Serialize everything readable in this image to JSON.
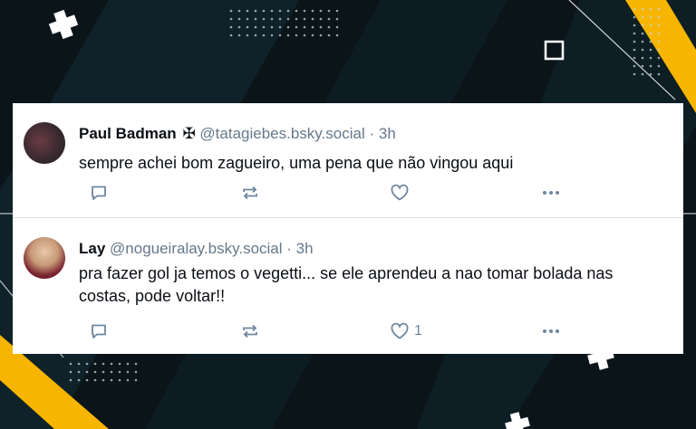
{
  "colors": {
    "background": "#0b1418",
    "accent_yellow": "#f7b500",
    "card": "#ffffff",
    "muted_text": "#66788a",
    "action_icon": "#6f869f"
  },
  "posts": [
    {
      "display_name": "Paul Badman",
      "badge": "✠",
      "handle": "@tatagiebes.bsky.social",
      "separator": "·",
      "time": "3h",
      "text": "sempre achei bom zagueiro, uma pena que não vingou aqui",
      "like_count": ""
    },
    {
      "display_name": "Lay",
      "badge": "",
      "handle": "@nogueiralay.bsky.social",
      "separator": "·",
      "time": "3h",
      "text": "pra fazer gol ja temos o vegetti... se ele aprendeu a nao tomar bolada nas costas, pode voltar!!",
      "like_count": "1"
    }
  ],
  "icons": {
    "reply": "reply-bubble-icon",
    "repost": "repost-arrows-icon",
    "like": "heart-icon",
    "more": "more-dots-icon"
  }
}
